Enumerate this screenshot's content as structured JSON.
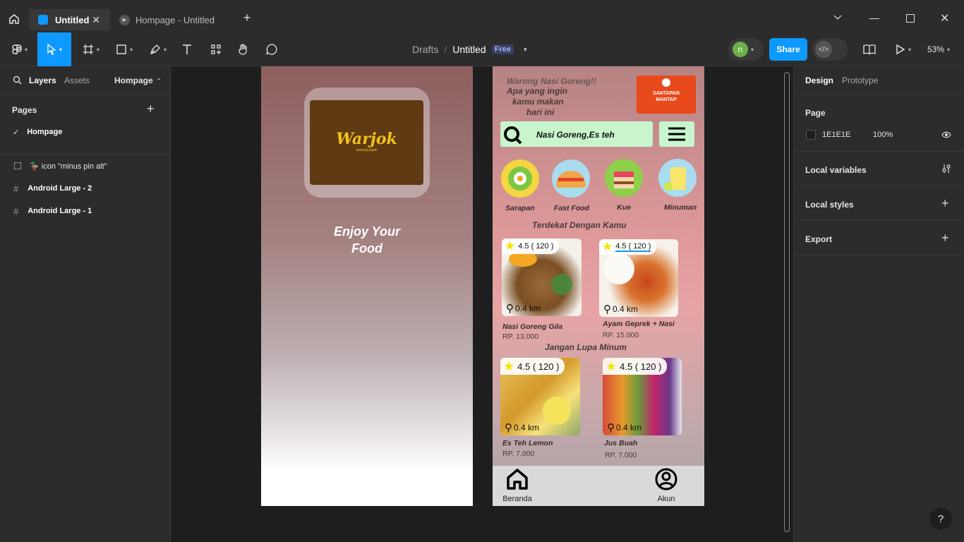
{
  "window": {
    "tabs": [
      {
        "label": "Untitled"
      },
      {
        "label": "Hompage - Untitled"
      }
    ]
  },
  "toolbar": {
    "breadcrumb_parent": "Drafts",
    "breadcrumb_sep": "/",
    "file_name": "Untitled",
    "plan_badge": "Free",
    "avatar_letter": "n",
    "share_label": "Share",
    "zoom": "53%"
  },
  "left_panel": {
    "tab_layers": "Layers",
    "tab_assets": "Assets",
    "page_selector": "Hompage",
    "pages_title": "Pages",
    "pages": [
      {
        "label": "Hompage",
        "selected": true
      }
    ],
    "layers": [
      {
        "label": "🦆 icon \"minus pin alt\"",
        "type": "component"
      },
      {
        "label": "Android Large - 2",
        "type": "frame"
      },
      {
        "label": "Android Large - 1",
        "type": "frame"
      }
    ]
  },
  "right_panel": {
    "tab_design": "Design",
    "tab_prototype": "Prototype",
    "page_title": "Page",
    "bg_hex": "1E1E1E",
    "bg_opacity": "100%",
    "local_variables": "Local variables",
    "local_styles": "Local styles",
    "export": "Export",
    "help": "?"
  },
  "frame1": {
    "logo_text": "Warjok",
    "logo_sub": "warung pojok",
    "tagline_line1": "Enjoy Your",
    "tagline_line2": "Food"
  },
  "frame2": {
    "greeting_1": "Warong Nasi Goreng!!",
    "greeting_2": "Apa yang ingin",
    "greeting_3": "kamu makan",
    "greeting_4": "hari ini",
    "badge_1": "SANTAPAN",
    "badge_2": "MANTAP",
    "search_text": "Nasi Goreng,Es teh",
    "categories": [
      {
        "label": "Sarapan"
      },
      {
        "label": "Fast Food"
      },
      {
        "label": "Kue"
      },
      {
        "label": "Minuman"
      }
    ],
    "section_near": "Terdekat Dengan Kamu",
    "section_drink": "Jangan Lupa Minum",
    "items": [
      {
        "name": "Nasi Goreng Gila",
        "price": "RP. 13.000",
        "rating": "4.5 ( 120 )",
        "distance": "0.4 km"
      },
      {
        "name": "Ayam Geprek + Nasi",
        "price": "RP. 15.000",
        "rating": "4.5 ( 120 )",
        "distance": "0.4 km"
      },
      {
        "name": "Es Teh Lemon",
        "price": "RP. 7.000",
        "rating": "4.5 ( 120 )",
        "distance": "0.4 km"
      },
      {
        "name": "Jus Buah",
        "price": "RP. 7.000",
        "rating": "4.5 ( 120 )",
        "distance": "0.4 km"
      }
    ],
    "nav": [
      {
        "label": "Beranda"
      },
      {
        "label": "Akun"
      }
    ]
  },
  "colors": {
    "accent": "#0d99ff",
    "badge_orange": "#e8491d",
    "search_green": "#c8f5cc",
    "logo_brown": "#5f3a12",
    "logo_yellow": "#f2c21b"
  }
}
